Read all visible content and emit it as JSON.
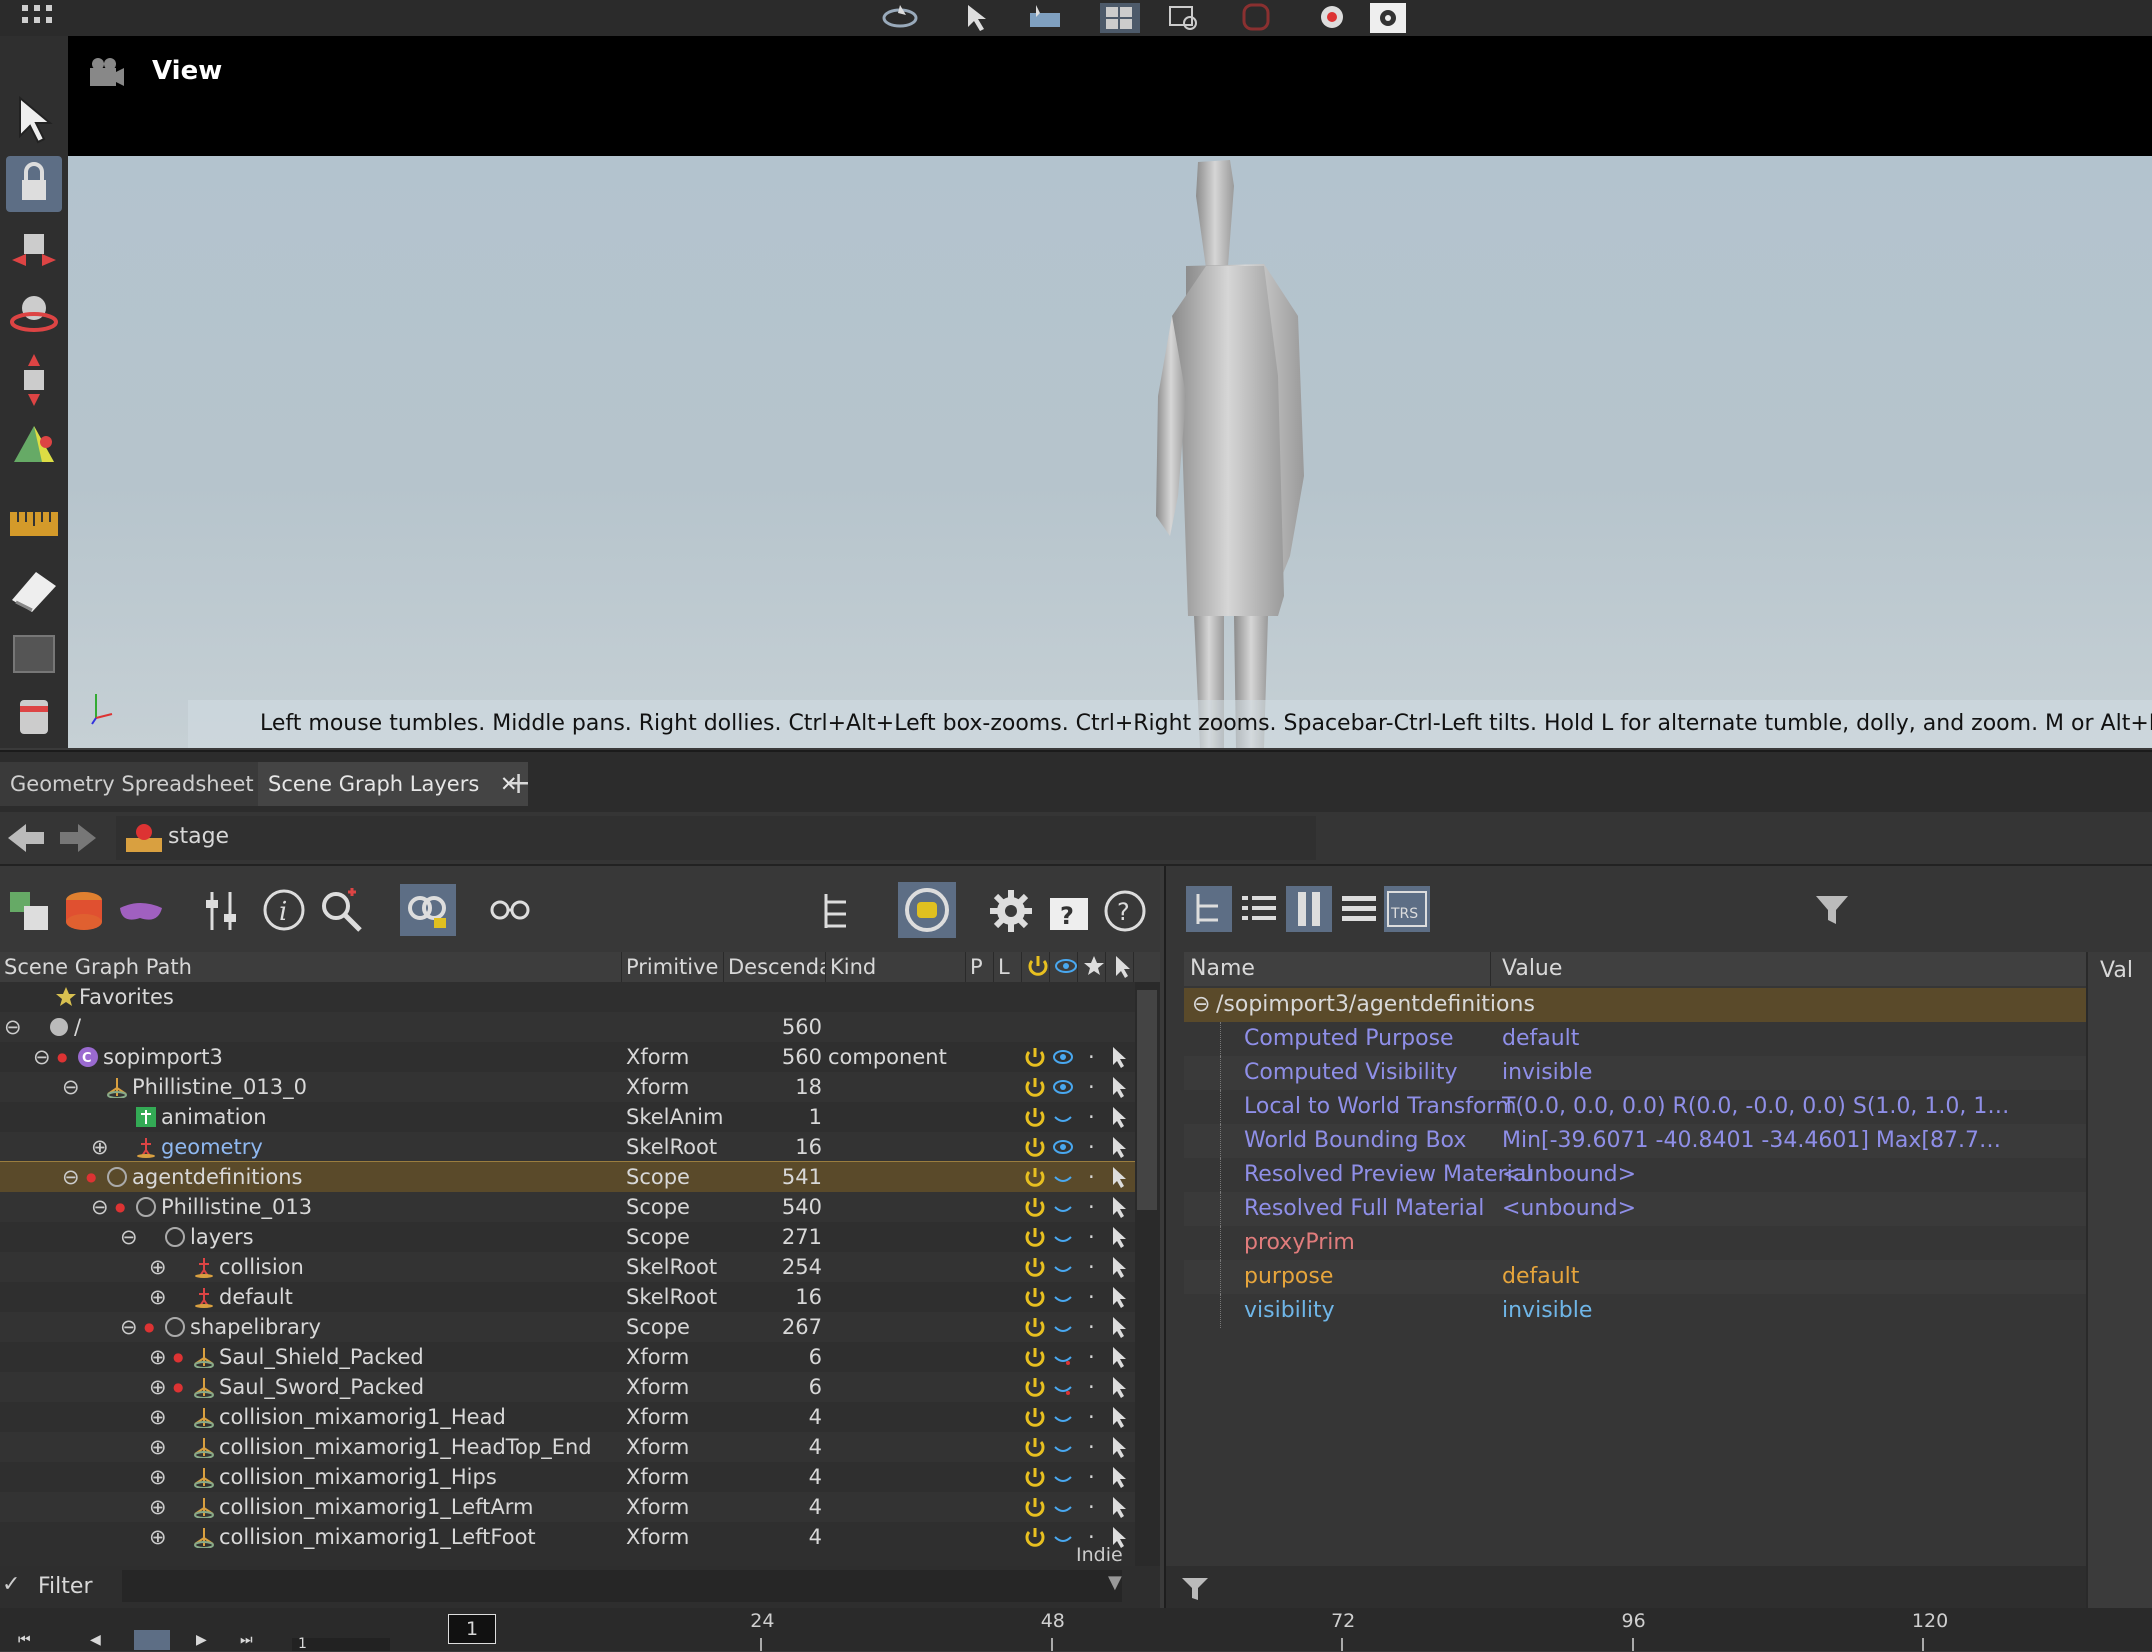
{
  "viewport": {
    "title": "View",
    "hint": "Left mouse tumbles. Middle pans. Right dollies. Ctrl+Alt+Left box-zooms. Ctrl+Right zooms. Spacebar-Ctrl-Left tilts. Hold L for alternate tumble, dolly, and zoom. M or Alt+M for First Person Navigation."
  },
  "tabs": [
    {
      "label": "Geometry Spreadsheet"
    },
    {
      "label": "Scene Graph Layers"
    }
  ],
  "path": {
    "label": "stage"
  },
  "scene_graph": {
    "columns": {
      "path": "Scene Graph Path",
      "primitive": "Primitive",
      "descendants": "Descenda",
      "kind": "Kind",
      "p": "P",
      "l": "L"
    },
    "rows": [
      {
        "name": "Favorites",
        "primitive": "",
        "descendants": "",
        "kind": ""
      },
      {
        "name": "/",
        "primitive": "",
        "descendants": "560",
        "kind": ""
      },
      {
        "name": "sopimport3",
        "primitive": "Xform",
        "descendants": "560",
        "kind": "component"
      },
      {
        "name": "Phillistine_013_0",
        "primitive": "Xform",
        "descendants": "18",
        "kind": ""
      },
      {
        "name": "animation",
        "primitive": "SkelAnim",
        "descendants": "1",
        "kind": ""
      },
      {
        "name": "geometry",
        "primitive": "SkelRoot",
        "descendants": "16",
        "kind": ""
      },
      {
        "name": "agentdefinitions",
        "primitive": "Scope",
        "descendants": "541",
        "kind": ""
      },
      {
        "name": "Phillistine_013",
        "primitive": "Scope",
        "descendants": "540",
        "kind": ""
      },
      {
        "name": "layers",
        "primitive": "Scope",
        "descendants": "271",
        "kind": ""
      },
      {
        "name": "collision",
        "primitive": "SkelRoot",
        "descendants": "254",
        "kind": ""
      },
      {
        "name": "default",
        "primitive": "SkelRoot",
        "descendants": "16",
        "kind": ""
      },
      {
        "name": "shapelibrary",
        "primitive": "Scope",
        "descendants": "267",
        "kind": ""
      },
      {
        "name": "Saul_Shield_Packed",
        "primitive": "Xform",
        "descendants": "6",
        "kind": ""
      },
      {
        "name": "Saul_Sword_Packed",
        "primitive": "Xform",
        "descendants": "6",
        "kind": ""
      },
      {
        "name": "collision_mixamorig1_Head",
        "primitive": "Xform",
        "descendants": "4",
        "kind": ""
      },
      {
        "name": "collision_mixamorig1_HeadTop_End",
        "primitive": "Xform",
        "descendants": "4",
        "kind": ""
      },
      {
        "name": "collision_mixamorig1_Hips",
        "primitive": "Xform",
        "descendants": "4",
        "kind": ""
      },
      {
        "name": "collision_mixamorig1_LeftArm",
        "primitive": "Xform",
        "descendants": "4",
        "kind": ""
      },
      {
        "name": "collision_mixamorig1_LeftFoot",
        "primitive": "Xform",
        "descendants": "4",
        "kind": ""
      }
    ],
    "indie_label": "Indie"
  },
  "properties": {
    "columns": {
      "name": "Name",
      "value": "Value",
      "extra": "Val"
    },
    "group": "/sopimport3/agentdefinitions",
    "rows": [
      {
        "name": "Computed Purpose",
        "value": "default"
      },
      {
        "name": "Computed Visibility",
        "value": "invisible"
      },
      {
        "name": "Local to World Transform",
        "value": "T(0.0, 0.0, 0.0) R(0.0, -0.0, 0.0) S(1.0, 1.0, 1…"
      },
      {
        "name": "World Bounding Box",
        "value": "Min[-39.6071 -40.8401 -34.4601] Max[87.7…"
      },
      {
        "name": "Resolved Preview Material",
        "value": "<unbound>"
      },
      {
        "name": "Resolved Full Material",
        "value": "<unbound>"
      },
      {
        "name": "proxyPrim",
        "value": ""
      },
      {
        "name": "purpose",
        "value": "default"
      },
      {
        "name": "visibility",
        "value": "invisible"
      }
    ]
  },
  "filter": {
    "label": "Filter"
  },
  "timeline": {
    "current_frame": "1",
    "frame_field": "1",
    "ticks": [
      "24",
      "48",
      "72",
      "96",
      "120"
    ]
  },
  "colors": {
    "selection": "#5a4a2a",
    "attr_computed": "#8f8fe8",
    "attr_proxy": "#e07c7c",
    "attr_purpose": "#e6a53c",
    "attr_visibility": "#6fb6e8",
    "power_icon": "#e8c020",
    "eye_icon": "#49a8f0"
  }
}
